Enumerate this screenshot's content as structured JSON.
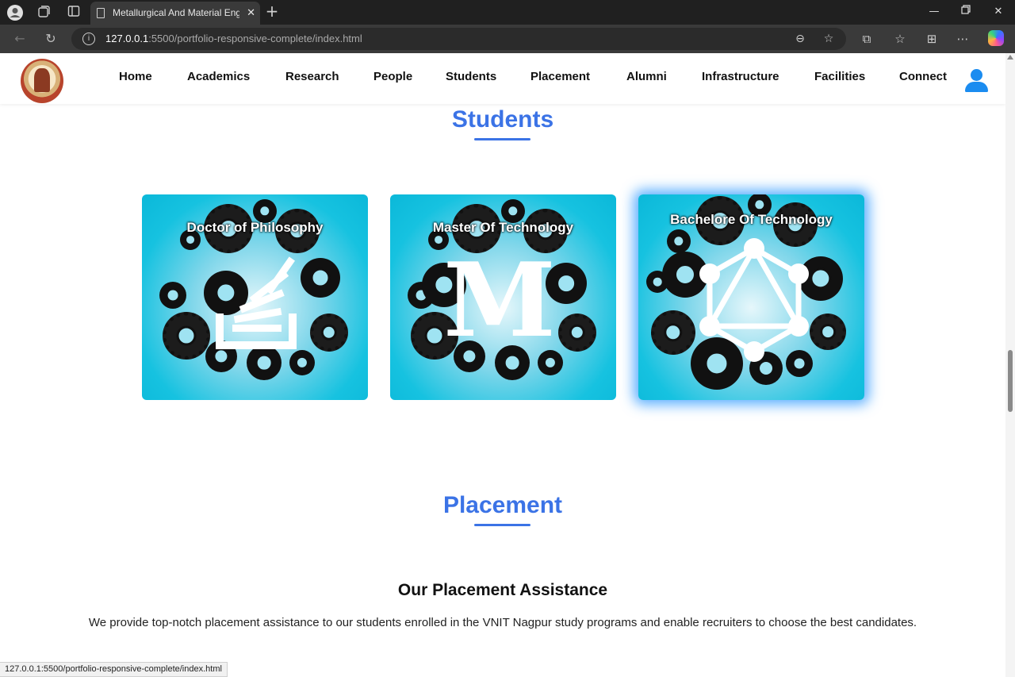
{
  "browser": {
    "tab_title": "Metallurgical And Material Engineering",
    "url_host": "127.0.0.1",
    "url_path": ":5500/portfolio-responsive-complete/index.html",
    "status_url": "127.0.0.1:5500/portfolio-responsive-complete/index.html"
  },
  "nav": {
    "items": [
      "Home",
      "Academics",
      "Research",
      "People",
      "Students",
      "Placement",
      "Alumni",
      "Infrastructure",
      "Facilities",
      "Connect"
    ]
  },
  "students": {
    "title": "Students",
    "cards": [
      {
        "title": "Doctor of Philosophy",
        "icon": "stack-icon"
      },
      {
        "title": "Master Of Technology",
        "icon": "letter-m-icon"
      },
      {
        "title": "Bachelore Of Technology",
        "icon": "graph-network-icon"
      }
    ]
  },
  "placement": {
    "title": "Placement",
    "subtitle": "Our Placement Assistance",
    "description": "We provide top-notch placement assistance to our students enrolled in the VNIT Nagpur study programs and enable recruiters to choose the best candidates."
  },
  "colors": {
    "accent": "#3b73e6",
    "card_bg": "#16c2e0",
    "user_icon": "#1b8cf0"
  }
}
